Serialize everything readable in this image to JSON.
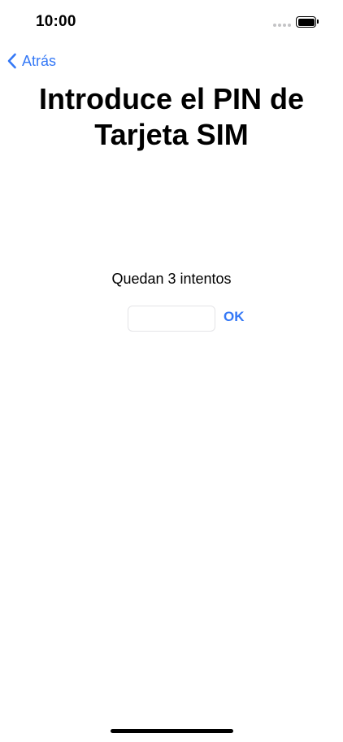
{
  "status_bar": {
    "time": "10:00"
  },
  "navigation": {
    "back_label": "Atrás",
    "back_icon": "chevron-left-icon"
  },
  "title": "Introduce el PIN de Tarjeta SIM",
  "attempts_text": "Quedan 3 intentos",
  "pin_field": {
    "value": "",
    "placeholder": ""
  },
  "ok_label": "OK",
  "colors": {
    "accent": "#3478f6",
    "text": "#000000",
    "background": "#ffffff"
  }
}
